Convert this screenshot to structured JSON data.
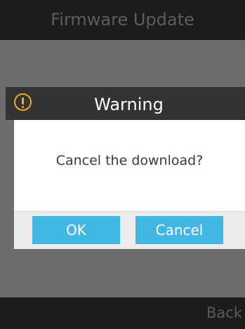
{
  "screen": {
    "title": "Firmware Update"
  },
  "dialog": {
    "title": "Warning",
    "icon": "warning-icon",
    "message": "Cancel the download?",
    "ok_label": "OK",
    "cancel_label": "Cancel"
  },
  "softkeys": {
    "back_label": "Back"
  },
  "colors": {
    "accent": "#42b6e4",
    "warning": "#f5a623",
    "overlay": "#6d6d6d",
    "bar": "#1c1c1c"
  }
}
